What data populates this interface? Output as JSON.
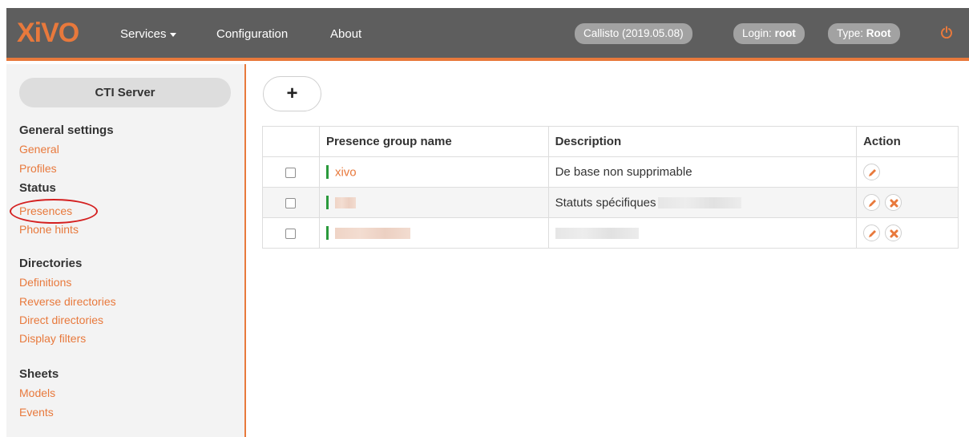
{
  "header": {
    "logo": "XiVO",
    "nav": {
      "services": "Services",
      "configuration": "Configuration",
      "about": "About"
    },
    "version": "Callisto (2019.05.08)",
    "login_label": "Login:",
    "login_value": "root",
    "type_label": "Type:",
    "type_value": "Root"
  },
  "sidebar": {
    "cti_button": "CTI Server",
    "sections": [
      {
        "title": "General settings",
        "items": [
          "General",
          "Profiles"
        ]
      },
      {
        "title": "Status",
        "items": [
          "Presences",
          "Phone hints"
        ]
      },
      {
        "title": "Directories",
        "items": [
          "Definitions",
          "Reverse directories",
          "Direct directories",
          "Display filters"
        ]
      },
      {
        "title": "Sheets",
        "items": [
          "Models",
          "Events"
        ]
      }
    ]
  },
  "main": {
    "add_button": "+",
    "table": {
      "headers": [
        "",
        "Presence group name",
        "Description",
        "Action"
      ],
      "rows": [
        {
          "name": "xivo",
          "description": "De base non supprimable"
        },
        {
          "name": "",
          "description": "Statuts spécifiques"
        },
        {
          "name": "",
          "description": ""
        }
      ]
    }
  },
  "colors": {
    "accent": "#e8793c",
    "topbar": "#5e5e5e",
    "status_bar": "#2a9a3c",
    "delete": "#e8793c",
    "annotation_circle": "#d42020"
  },
  "icons": [
    "caret-down-icon",
    "power-icon",
    "plus-icon",
    "edit-icon",
    "delete-icon"
  ]
}
